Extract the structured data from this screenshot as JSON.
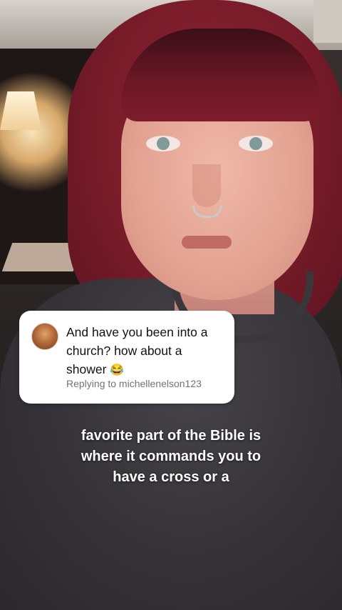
{
  "comment": {
    "text_line1": "And have you been into a",
    "text_line2": "church?  how about a",
    "text_line3": "shower",
    "emoji": "😂",
    "replying_to": "Replying to michellenelson123"
  },
  "caption": {
    "lines": [
      "favorite part of the Bible is",
      "where it commands you to",
      "have a cross or a"
    ]
  },
  "colors": {
    "card_background": "#ffffff",
    "reply_text": "#737373",
    "caption_text": "#ffffff",
    "hair": "#7a1c2a",
    "sweater": "#38353a"
  },
  "icons": {
    "avatar": "commenter-avatar-icon"
  }
}
